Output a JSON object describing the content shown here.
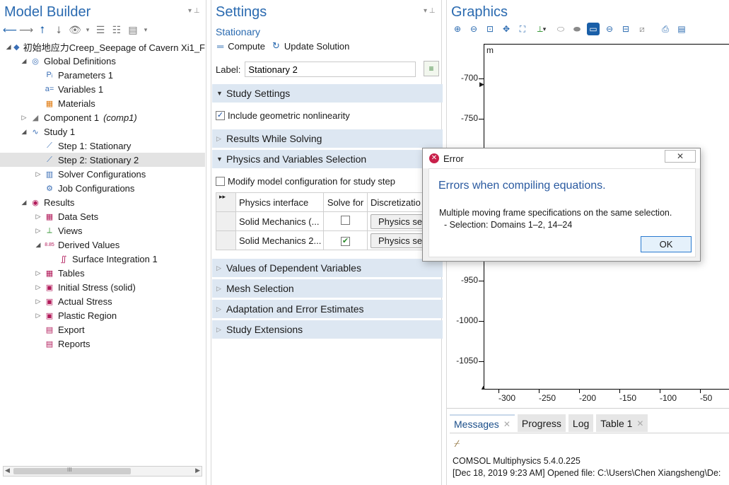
{
  "model_builder": {
    "title": "Model Builder",
    "tree": [
      {
        "label": "初始地应力Creep_Seepage of Cavern Xi1_F",
        "icon": "model-icon",
        "twisty": "▲",
        "indent": 0
      },
      {
        "label": "Global Definitions",
        "icon": "globe-icon",
        "twisty": "▲",
        "indent": 1
      },
      {
        "label": "Parameters 1",
        "icon": "parameters-icon",
        "twisty": "",
        "indent": 2,
        "glyph": "Pᵢ"
      },
      {
        "label": "Variables 1",
        "icon": "variables-icon",
        "twisty": "",
        "indent": 2,
        "glyph": "a="
      },
      {
        "label": "Materials",
        "icon": "materials-icon",
        "twisty": "",
        "indent": 2,
        "glyph": "▦"
      },
      {
        "label": "Component 1",
        "sub": "(comp1)",
        "icon": "component-icon",
        "twisty": "▷",
        "indent": 1
      },
      {
        "label": "Study 1",
        "icon": "study-icon",
        "twisty": "▲",
        "indent": 1
      },
      {
        "label": "Step 1: Stationary",
        "icon": "stationary-step-icon",
        "twisty": "",
        "indent": 2
      },
      {
        "label": "Step 2: Stationary 2",
        "icon": "stationary-step-icon",
        "twisty": "",
        "indent": 2,
        "selected": true
      },
      {
        "label": "Solver Configurations",
        "icon": "solver-icon",
        "twisty": "▷",
        "indent": 2
      },
      {
        "label": "Job Configurations",
        "icon": "job-icon",
        "twisty": "",
        "indent": 2
      },
      {
        "label": "Results",
        "icon": "results-icon",
        "twisty": "▲",
        "indent": 1
      },
      {
        "label": "Data Sets",
        "icon": "datasets-icon",
        "twisty": "▷",
        "indent": 2
      },
      {
        "label": "Views",
        "icon": "views-icon",
        "twisty": "▷",
        "indent": 2
      },
      {
        "label": "Derived Values",
        "icon": "derived-values-icon",
        "twisty": "▲",
        "indent": 2,
        "glyph": "8.85"
      },
      {
        "label": "Surface Integration 1",
        "icon": "integral-icon",
        "twisty": "",
        "indent": 3,
        "glyph": "∬"
      },
      {
        "label": "Tables",
        "icon": "table-icon",
        "twisty": "▷",
        "indent": 2
      },
      {
        "label": "Initial Stress (solid)",
        "icon": "plot-group-icon",
        "twisty": "▷",
        "indent": 2
      },
      {
        "label": "Actual Stress",
        "icon": "plot-group-icon",
        "twisty": "▷",
        "indent": 2
      },
      {
        "label": "Plastic Region",
        "icon": "plot-group-icon",
        "twisty": "▷",
        "indent": 2
      },
      {
        "label": "Export",
        "icon": "export-icon",
        "twisty": "",
        "indent": 2
      },
      {
        "label": "Reports",
        "icon": "reports-icon",
        "twisty": "",
        "indent": 2
      }
    ],
    "scroll_mid": "III"
  },
  "settings": {
    "title": "Settings",
    "subtitle": "Stationary",
    "compute_label": "Compute",
    "update_label": "Update Solution",
    "label_caption": "Label:",
    "label_value": "Stationary 2",
    "sections": {
      "study_settings": "Study Settings",
      "results_while_solving": "Results While Solving",
      "physics_selection": "Physics and Variables Selection",
      "dependent_values": "Values of Dependent Variables",
      "mesh_selection": "Mesh Selection",
      "adaptation": "Adaptation and Error Estimates",
      "study_extensions": "Study Extensions"
    },
    "include_nonlinearity": "Include geometric nonlinearity",
    "modify_model": "Modify model configuration for study step",
    "table": {
      "headers": [
        "Physics interface",
        "Solve for",
        "Discretizatio"
      ],
      "rows": [
        {
          "interface": "Solid Mechanics (...",
          "solve": false,
          "disc": "Physics set"
        },
        {
          "interface": "Solid Mechanics 2...",
          "solve": true,
          "disc": "Physics set"
        }
      ]
    }
  },
  "graphics": {
    "title": "Graphics",
    "unit": "m",
    "yticks": [
      "-700",
      "-750",
      "-950",
      "-1000",
      "-1050"
    ],
    "xticks": [
      "-300",
      "-250",
      "-200",
      "-150",
      "-100",
      "-50"
    ]
  },
  "messages": {
    "tabs": [
      "Messages",
      "Progress",
      "Log",
      "Table 1"
    ],
    "lines": [
      "COMSOL Multiphysics 5.4.0.225",
      "[Dec 18, 2019 9:23 AM] Opened file: C:\\Users\\Chen Xiangsheng\\De:"
    ]
  },
  "dialog": {
    "title": "Error",
    "heading": "Errors when compiling equations.",
    "message": "Multiple moving frame specifications on the same selection.\n  - Selection: Domains 1–2, 14–24",
    "ok_label": "OK"
  }
}
